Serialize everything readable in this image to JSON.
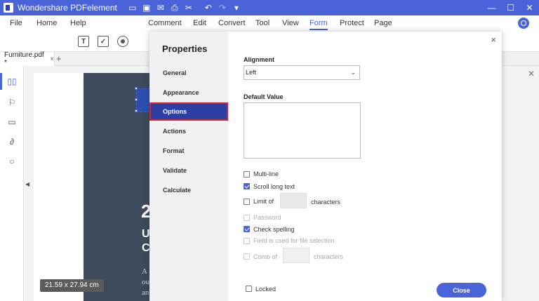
{
  "app": {
    "title": "Wondershare PDFelement"
  },
  "quick_access": [
    "folder-icon",
    "save-icon",
    "mail-icon",
    "print-icon",
    "cut-icon",
    "undo-icon",
    "redo-icon",
    "dropdown-icon"
  ],
  "window_controls": {
    "minimize": "—",
    "maximize": "☐",
    "close": "✕"
  },
  "menu": {
    "file": "File",
    "home": "Home",
    "help": "Help",
    "comment": "Comment",
    "edit": "Edit",
    "convert": "Convert",
    "tool": "Tool",
    "view": "View",
    "form": "Form",
    "protect": "Protect",
    "page": "Page",
    "active": "Form",
    "accent": "#4a63d8"
  },
  "toolbar": {
    "text_field_glyph": "T"
  },
  "document_tab": {
    "label": "Furniture.pdf *",
    "close": "×",
    "new_tab": "+"
  },
  "page": {
    "big": "2",
    "mid_line1": "U",
    "mid_line2": "C",
    "small_line1": "A",
    "small_line2": "ou",
    "small_line3": "an",
    "size": "21.59 x 27.94 cm"
  },
  "dialog": {
    "title": "Properties",
    "close": "×",
    "nav": [
      "General",
      "Appearance",
      "Options",
      "Actions",
      "Format",
      "Validate",
      "Calculate"
    ],
    "active_nav": "Options",
    "alignment_label": "Alignment",
    "alignment_value": "Left",
    "default_value_label": "Default Value",
    "options": {
      "multi_line": "Multi-line",
      "scroll_long_text": "Scroll long text",
      "limit_of": "Limit of",
      "limit_chars": "characters",
      "password": "Password",
      "check_spelling": "Check spelling",
      "file_selection": "Field is used for file selection",
      "comb_of": "Comb of",
      "comb_chars": "characters",
      "locked": "Locked"
    },
    "checked": {
      "multi_line": false,
      "scroll_long_text": true,
      "limit_of": false,
      "password": false,
      "check_spelling": true,
      "file_selection": false,
      "comb_of": false,
      "locked": false
    },
    "close_button": "Close"
  }
}
